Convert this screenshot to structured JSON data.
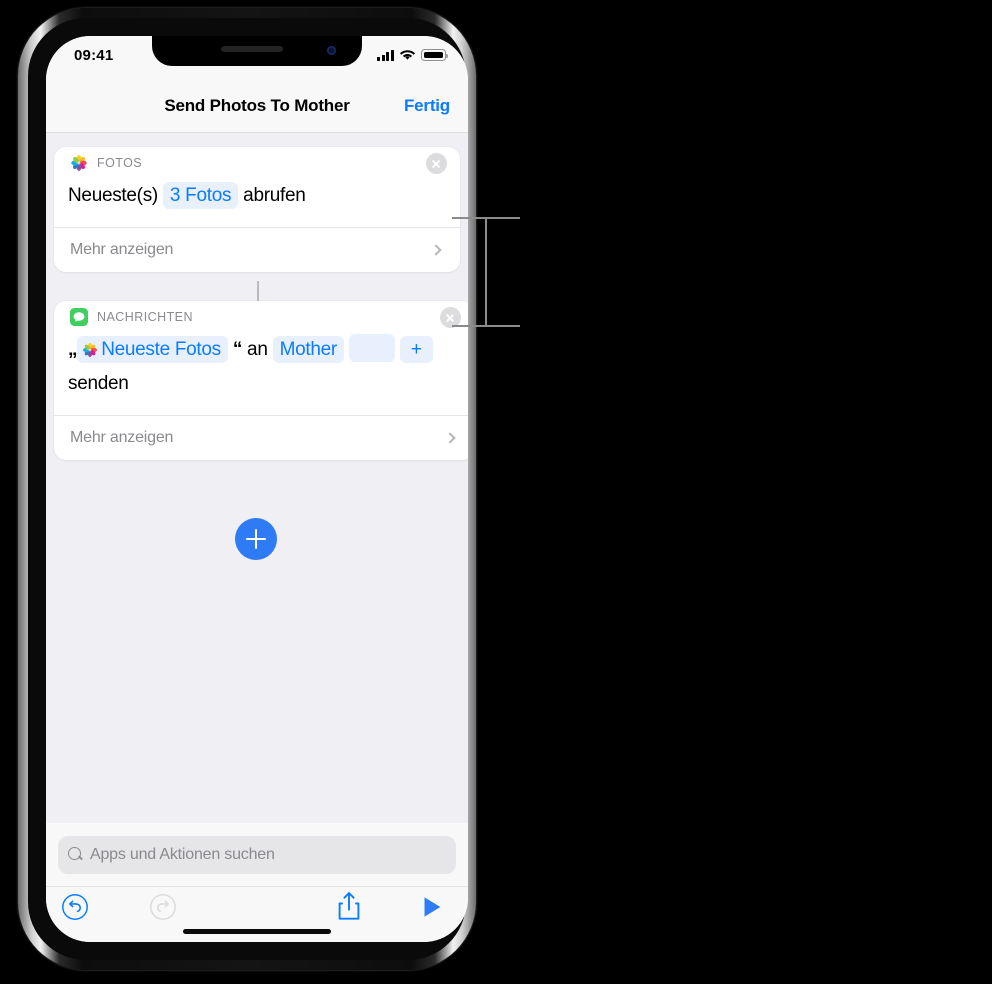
{
  "status_bar": {
    "time": "09:41",
    "cellular_icon": "signal-bars-icon",
    "wifi_icon": "wifi-icon",
    "battery_icon": "battery-icon"
  },
  "nav_bar": {
    "title": "Send Photos To Mother",
    "done_label": "Fertig"
  },
  "accent_color": "#0a7cff",
  "add_button_color": "#2f7bf6",
  "actions": [
    {
      "app_name": "FOTOS",
      "app_icon": "photos-icon",
      "close_icon": "close-icon",
      "text_before": "Neueste(s)",
      "token": "3 Fotos",
      "text_after": "abrufen",
      "more_label": "Mehr anzeigen",
      "chevron_icon": "chevron-right-icon"
    },
    {
      "app_name": "NACHRICHTEN",
      "app_icon": "messages-icon",
      "close_icon": "close-icon",
      "quote_open": "„",
      "token_variable": "Neueste Fotos",
      "token_variable_icon": "photos-icon",
      "quote_close": "“",
      "text_middle": "an",
      "token_recipient": "Mother",
      "token_add": "+",
      "text_after": "senden",
      "more_label": "Mehr anzeigen",
      "chevron_icon": "chevron-right-icon"
    }
  ],
  "add_button": {
    "label": "+",
    "icon": "plus-icon"
  },
  "bottom_bar": {
    "search_placeholder": "Apps und Aktionen suchen",
    "search_value": "",
    "search_icon": "search-icon",
    "tools": [
      {
        "name": "undo-button",
        "icon": "undo-icon",
        "state": "enabled"
      },
      {
        "name": "redo-button",
        "icon": "redo-icon",
        "state": "disabled"
      },
      {
        "name": "share-button",
        "icon": "share-icon",
        "state": "enabled"
      },
      {
        "name": "run-button",
        "icon": "play-icon",
        "state": "enabled"
      }
    ]
  }
}
